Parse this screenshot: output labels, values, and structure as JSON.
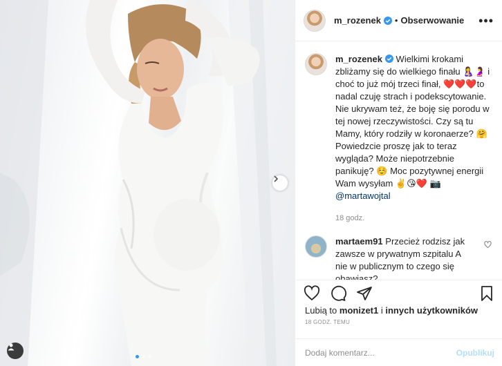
{
  "post": {
    "author": "m_rozenek",
    "separator": "•",
    "follow_label": "Obserwowanie",
    "more_icon": "more-horizontal-icon"
  },
  "caption": {
    "author": "m_rozenek",
    "text": "Wielkimi krokami zbliżamy się do wielkiego finału 🤱🤰 i choć to już mój trzeci finał, ❤️❤️❤️to nadal czuję strach i podekscytowanie. Nie ukrywam też, że boję się porodu w tej nowej rzeczywistości. Czy są tu Mamy, który rodziły w koronaerze? 🤗 Powiedzcie proszę jak to teraz wygląda? Może niepotrzebnie panikuję? ☺️ Moc pozytywnej energii Wam wysyłam ✌️😘❤️ 📷",
    "mention": "@martawojtal",
    "time": "18 godz."
  },
  "comment": {
    "author": "martaem91",
    "text": "Przecież rodzisz jak zawsze w prywatnym szpitalu A nie w publicznym to czego się obawiasz?"
  },
  "likes": {
    "prefix": "Lubią to",
    "user": "monizet1",
    "connector": "i",
    "others": "innych użytkowników"
  },
  "date": "18 GODZ. TEMU",
  "add_comment": {
    "placeholder": "Dodaj komentarz...",
    "publish_label": "Opublikuj"
  },
  "carousel": {
    "total": 3,
    "active": 1
  },
  "colors": {
    "accent": "#3897f0",
    "publish_disabled": "#b2dffc",
    "mention": "#003569",
    "muted": "#8e8e8e"
  }
}
